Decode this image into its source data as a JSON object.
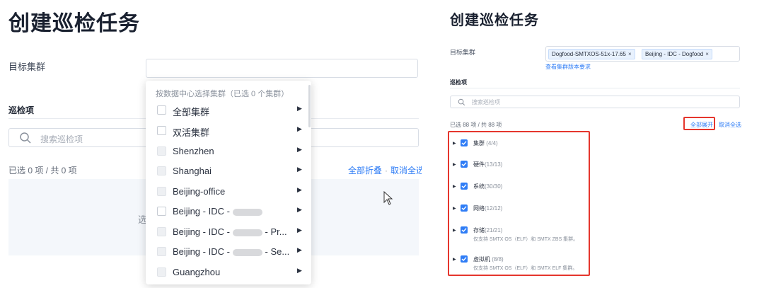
{
  "left": {
    "title": "创建巡检任务",
    "target_cluster_label": "目标集群",
    "inspection_section": "巡检项",
    "search_placeholder": "搜索巡检项",
    "selected_count": "已选 0 项 / 共 0 项",
    "collapse_all": "全部折叠",
    "separator": "·",
    "deselect_all": "取消全选",
    "empty_text": "选",
    "dropdown": {
      "header": "按数据中心选择集群（已选 0 个集群）",
      "items": [
        {
          "label": "全部集群",
          "enabled": true
        },
        {
          "label": "双活集群",
          "enabled": true
        },
        {
          "label": "Shenzhen",
          "enabled": false
        },
        {
          "label": "Shanghai",
          "enabled": false
        },
        {
          "label": "Beijing-office",
          "enabled": false
        },
        {
          "label": "Beijing - IDC -",
          "enabled": true,
          "blurred": true
        },
        {
          "label": "Beijing - IDC -",
          "suffix": "- Pr...",
          "enabled": false,
          "blurred": true
        },
        {
          "label": "Beijing - IDC -",
          "suffix": "- Se...",
          "enabled": false,
          "blurred": true
        },
        {
          "label": "Guangzhou",
          "enabled": false
        }
      ]
    }
  },
  "right": {
    "title": "创建巡检任务",
    "target_cluster_label": "目标集群",
    "tags": [
      {
        "label": "Dogfood-SMTXOS-51x-17.65",
        "remove": "×"
      },
      {
        "label": "Beijing - IDC - Dogfood",
        "remove": "×"
      }
    ],
    "version_link": "查看集群版本要求",
    "inspection_section": "巡检项",
    "search_placeholder": "搜索巡检项",
    "selected_count": "已选 88 项 / 共 88 项",
    "expand_all": "全部展开",
    "deselect_all": "取消全选",
    "items": [
      {
        "name": "集群",
        "count": "(4/4)",
        "note": ""
      },
      {
        "name": "硬件",
        "count": "(13/13)",
        "note": ""
      },
      {
        "name": "系统",
        "count": "(30/30)",
        "note": ""
      },
      {
        "name": "网络",
        "count": "(12/12)",
        "note": ""
      },
      {
        "name": "存储",
        "count": "(21/21)",
        "note": "仅支持 SMTX OS（ELF）和 SMTX ZBS 集群。"
      },
      {
        "name": "虚拟机",
        "count": "(8/8)",
        "note": "仅支持 SMTX OS（ELF）和 SMTX ELF 集群。"
      }
    ]
  },
  "colors": {
    "accent": "#2f7df6",
    "highlight_border": "#e5362d",
    "title_text": "#1a2130"
  }
}
